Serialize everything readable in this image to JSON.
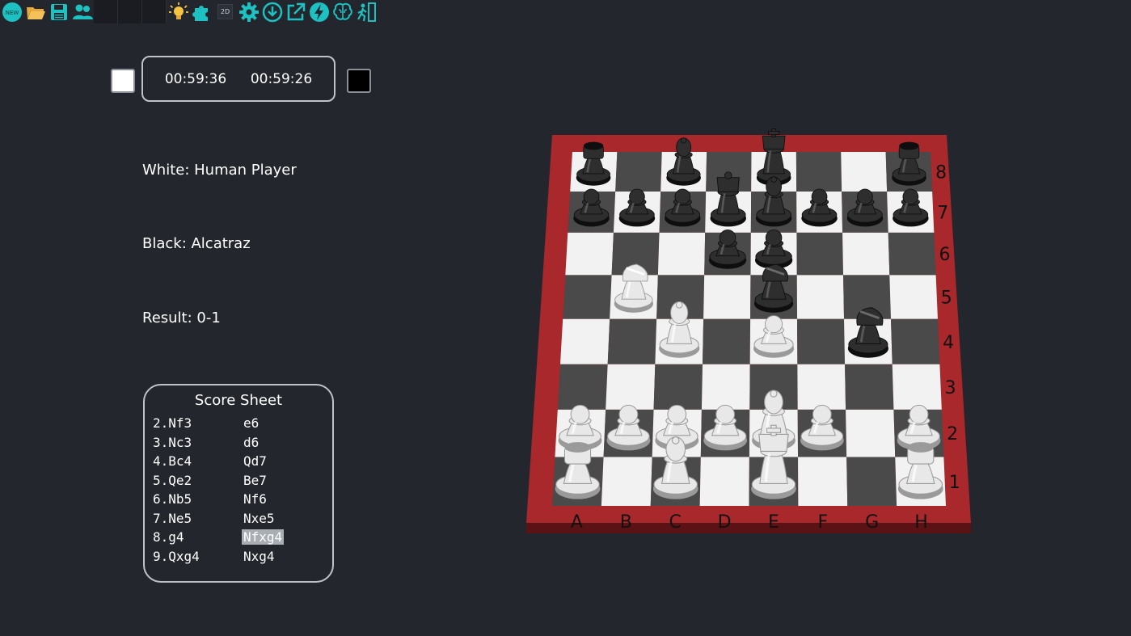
{
  "toolbar": {
    "new_label": "NEW",
    "mode_label": "2D",
    "icons": [
      "new-game-icon",
      "open-folder-icon",
      "save-disk-icon",
      "players-icon",
      "blank-slot",
      "blank-slot",
      "blank-slot",
      "hint-lightbulb-icon",
      "puzzle-icon",
      "2d-mode-toggle",
      "settings-gear-icon",
      "download-icon",
      "export-icon",
      "lightning-icon",
      "brain-icon",
      "resign-runner-icon"
    ],
    "accent": "#1ec1c1"
  },
  "clock": {
    "white_time": "00:59:36",
    "black_time": "00:59:26"
  },
  "players": {
    "white": "White: Human Player",
    "black": "Black: Alcatraz",
    "result": "Result: 0-1"
  },
  "scoresheet": {
    "title": "Score Sheet",
    "moves": [
      {
        "white": "2.Nf3",
        "black": "e6"
      },
      {
        "white": "3.Nc3",
        "black": "d6"
      },
      {
        "white": "4.Bc4",
        "black": "Qd7"
      },
      {
        "white": "5.Qe2",
        "black": "Be7"
      },
      {
        "white": "6.Nb5",
        "black": "Nf6"
      },
      {
        "white": "7.Ne5",
        "black": "Nxe5"
      },
      {
        "white": "8.g4",
        "black": "Nfxg4",
        "highlight": true
      },
      {
        "white": "9.Qxg4",
        "black": "Nxg4"
      }
    ]
  },
  "board": {
    "files": [
      "A",
      "B",
      "C",
      "D",
      "E",
      "F",
      "G",
      "H"
    ],
    "ranks": [
      "8",
      "7",
      "6",
      "5",
      "4",
      "3",
      "2",
      "1"
    ],
    "frame_color": "#a8282c",
    "light_square": "#f2f2f2",
    "dark_square": "#4a4a4a",
    "pieces": [
      {
        "sq": "a8",
        "p": "r",
        "c": "b"
      },
      {
        "sq": "c8",
        "p": "b",
        "c": "b"
      },
      {
        "sq": "e8",
        "p": "k",
        "c": "b"
      },
      {
        "sq": "h8",
        "p": "r",
        "c": "b"
      },
      {
        "sq": "a7",
        "p": "p",
        "c": "b"
      },
      {
        "sq": "b7",
        "p": "p",
        "c": "b"
      },
      {
        "sq": "c7",
        "p": "p",
        "c": "b"
      },
      {
        "sq": "d7",
        "p": "q",
        "c": "b"
      },
      {
        "sq": "e7",
        "p": "b",
        "c": "b"
      },
      {
        "sq": "f7",
        "p": "p",
        "c": "b"
      },
      {
        "sq": "g7",
        "p": "p",
        "c": "b"
      },
      {
        "sq": "h7",
        "p": "p",
        "c": "b"
      },
      {
        "sq": "d6",
        "p": "p",
        "c": "b"
      },
      {
        "sq": "e6",
        "p": "p",
        "c": "b"
      },
      {
        "sq": "b5",
        "p": "n",
        "c": "w"
      },
      {
        "sq": "e5",
        "p": "n",
        "c": "b"
      },
      {
        "sq": "c4",
        "p": "b",
        "c": "w"
      },
      {
        "sq": "e4",
        "p": "p",
        "c": "w"
      },
      {
        "sq": "g4",
        "p": "n",
        "c": "b"
      },
      {
        "sq": "a2",
        "p": "p",
        "c": "w"
      },
      {
        "sq": "b2",
        "p": "p",
        "c": "w"
      },
      {
        "sq": "c2",
        "p": "p",
        "c": "w"
      },
      {
        "sq": "d2",
        "p": "p",
        "c": "w"
      },
      {
        "sq": "e2",
        "p": "b",
        "c": "w"
      },
      {
        "sq": "f2",
        "p": "p",
        "c": "w"
      },
      {
        "sq": "h2",
        "p": "p",
        "c": "w"
      },
      {
        "sq": "a1",
        "p": "r",
        "c": "w"
      },
      {
        "sq": "c1",
        "p": "b",
        "c": "w"
      },
      {
        "sq": "e1",
        "p": "k",
        "c": "w"
      },
      {
        "sq": "h1",
        "p": "r",
        "c": "w"
      }
    ]
  }
}
